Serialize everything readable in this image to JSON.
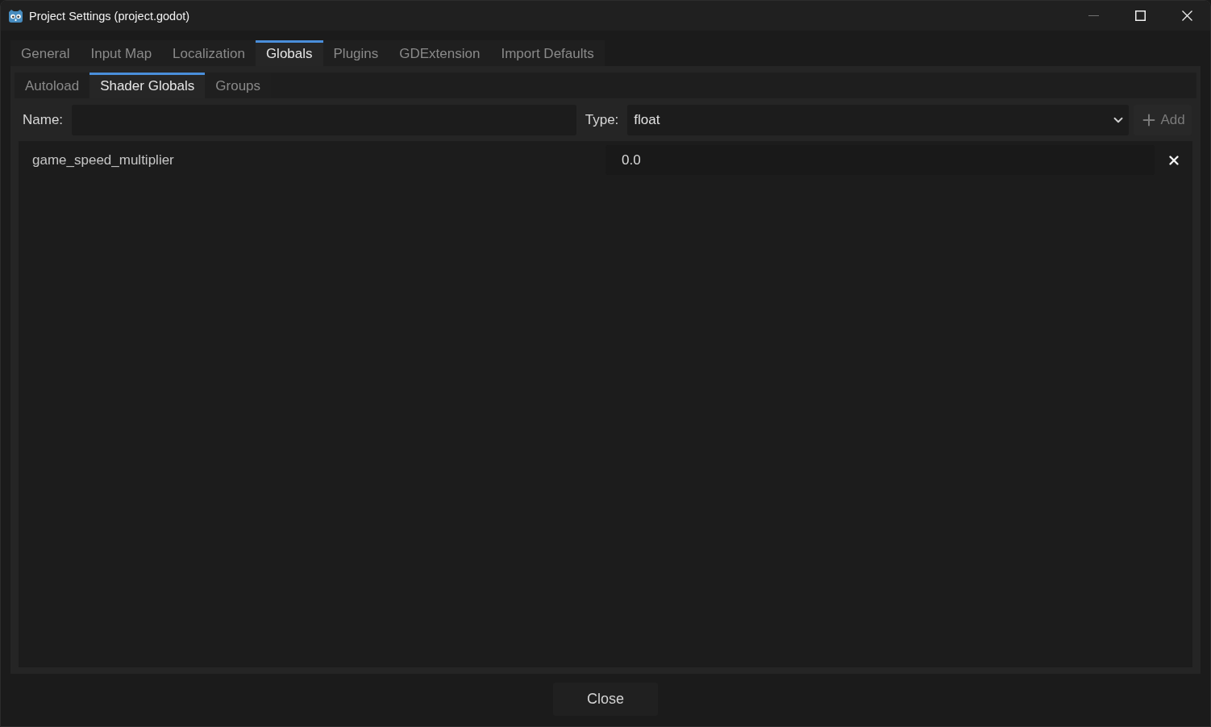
{
  "window": {
    "title": "Project Settings (project.godot)"
  },
  "tabs": [
    {
      "label": "General",
      "selected": false
    },
    {
      "label": "Input Map",
      "selected": false
    },
    {
      "label": "Localization",
      "selected": false
    },
    {
      "label": "Globals",
      "selected": true
    },
    {
      "label": "Plugins",
      "selected": false
    },
    {
      "label": "GDExtension",
      "selected": false
    },
    {
      "label": "Import Defaults",
      "selected": false
    }
  ],
  "subtabs": [
    {
      "label": "Autoload",
      "selected": false
    },
    {
      "label": "Shader Globals",
      "selected": true
    },
    {
      "label": "Groups",
      "selected": false
    }
  ],
  "add_form": {
    "name_label": "Name:",
    "type_label": "Type:",
    "type_value": "float",
    "add_button": {
      "label": "Add",
      "disabled": true
    }
  },
  "globals": [
    {
      "name": "game_speed_multiplier",
      "value": "0.0"
    }
  ],
  "footer": {
    "close_button": "Close"
  }
}
